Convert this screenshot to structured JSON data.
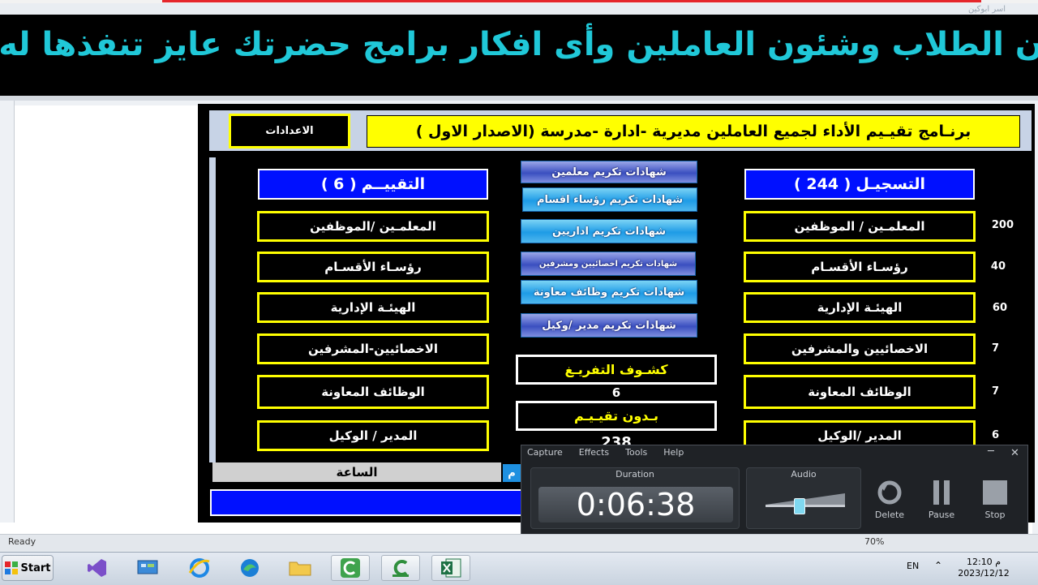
{
  "window": {
    "top_name": "اسر ابوكين"
  },
  "ticker": {
    "text": "ن الطلاب وشئون العاملين وأى افكار برامج حضرتك عايز تنفذها له"
  },
  "form": {
    "title": "برنـامج تقيـيم الأداء لجميع العاملين مديرية -ادارة -مدرسة (الاصدار الاول )",
    "settings_label": "الاعدادات",
    "registration": {
      "label": "التسجيـل",
      "count": "( 244 )"
    },
    "evaluation": {
      "label": "التقييــم",
      "count": "( 6 )"
    },
    "reg_items": [
      {
        "label": "المعلمـين / الموظفين",
        "count": "200"
      },
      {
        "label": "رؤسـاء الأقسـام",
        "count": "40"
      },
      {
        "label": "الهيئـة الإدارية",
        "count": "60"
      },
      {
        "label": "الاخصائيين والمشرفين",
        "count": "7"
      },
      {
        "label": "الوظائف المعاونة",
        "count": "7"
      },
      {
        "label": "المدير /الوكيل",
        "count": "6"
      }
    ],
    "eval_items": [
      {
        "label": "المعلمـين /الموظفين"
      },
      {
        "label": "رؤسـاء الأقسـام"
      },
      {
        "label": "الهيئـة الإدارية"
      },
      {
        "label": "الاخصائيين-المشرفين"
      },
      {
        "label": "الوظائف المعاونة"
      },
      {
        "label": "المدير / الوكيل"
      }
    ],
    "certs": [
      {
        "label": "شهادات تكريم معلمين"
      },
      {
        "label": "شهادات تكريم رؤساء اقسام"
      },
      {
        "label": "شهادات تكريم اداريين"
      },
      {
        "label": "شهادات تكريم اخصائيين ومشرفين"
      },
      {
        "label": "شهادات تكريم وظائف معاونة"
      },
      {
        "label": "شهادات تكريم مدير /وكيل"
      }
    ],
    "summary": {
      "kashf_label": "كشـوف التفريـغ",
      "kashf_value": "6",
      "no_eval_label": "بـدون تقيـيـم",
      "no_eval_value": "238"
    },
    "clock_label": "الساعة",
    "clock_small": "م"
  },
  "recorder": {
    "menu": [
      "Capture",
      "Effects",
      "Tools",
      "Help"
    ],
    "duration_label": "Duration",
    "duration_value": "0:06:38",
    "audio_label": "Audio",
    "audio_level": 0.42,
    "controls": {
      "delete": "Delete",
      "pause": "Pause",
      "stop": "Stop"
    }
  },
  "status": {
    "ready": "Ready",
    "zoom": "70%"
  },
  "taskbar": {
    "start_label": "Start",
    "lang": "EN",
    "time": "12:10 م",
    "date": "2023/12/12"
  },
  "colors": {
    "highlight": "#ffff00",
    "header_blue": "#0010ff",
    "ticker_cyan": "#20c8d8"
  }
}
